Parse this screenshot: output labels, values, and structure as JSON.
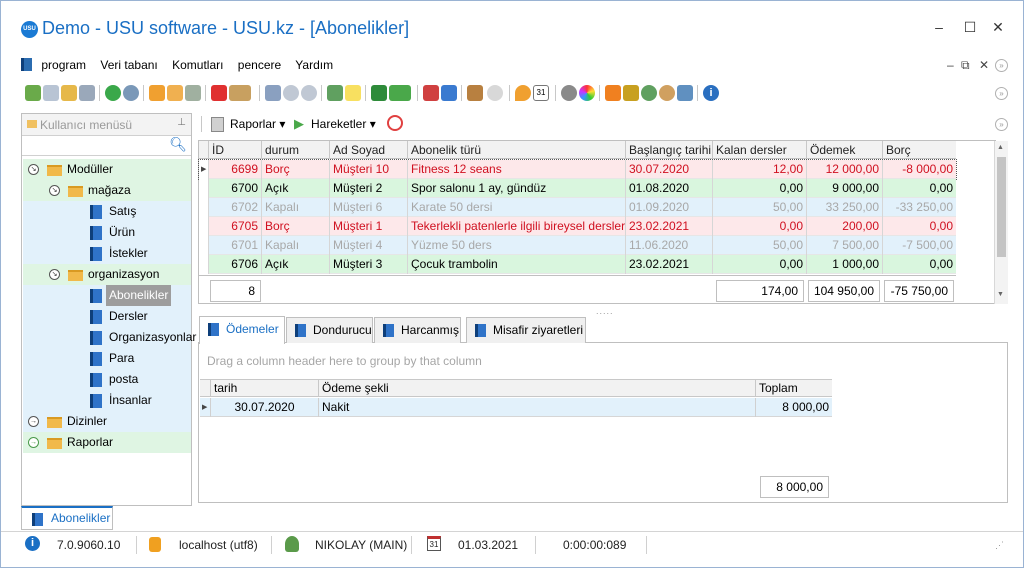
{
  "window": {
    "title": "Demo - USU software - USU.kz - [Abonelikler]",
    "app_icon_text": "USU",
    "controls": [
      "–",
      "☐",
      "✕"
    ]
  },
  "menu": {
    "items": [
      "program",
      "Veri tabanı",
      "Komutları",
      "pencere",
      "Yardım"
    ],
    "mdi_controls": [
      "–",
      "⧉",
      "✕"
    ]
  },
  "sidebar": {
    "title": "Kullanıcı menüsü",
    "items": [
      {
        "label": "Modüller",
        "kind": "root"
      },
      {
        "label": "mağaza",
        "kind": "folder"
      },
      {
        "label": "Satış",
        "kind": "leaf"
      },
      {
        "label": "Ürün",
        "kind": "leaf"
      },
      {
        "label": "İstekler",
        "kind": "leaf"
      },
      {
        "label": "organizasyon",
        "kind": "folder"
      },
      {
        "label": "Abonelikler",
        "kind": "leaf-selected"
      },
      {
        "label": "Dersler",
        "kind": "leaf"
      },
      {
        "label": "Organizasyonlar",
        "kind": "leaf"
      },
      {
        "label": "Para",
        "kind": "leaf"
      },
      {
        "label": "posta",
        "kind": "leaf"
      },
      {
        "label": "İnsanlar",
        "kind": "leaf"
      },
      {
        "label": "Dizinler",
        "kind": "root"
      },
      {
        "label": "Raporlar",
        "kind": "root"
      }
    ]
  },
  "actions": {
    "reports": "Raporlar",
    "actions": "Hareketler"
  },
  "grid": {
    "columns": [
      "İD",
      "durum",
      "Ad Soyad",
      "Abonelik türü",
      "Başlangıç tarihi",
      "Kalan dersler",
      "Ödemek",
      "Borç"
    ],
    "rows": [
      {
        "id": "6699",
        "durum": "Borç",
        "ad": "Müşteri 10",
        "tur": "Fitness 12 seans",
        "tarih": "30.07.2020",
        "kalan": "12,00",
        "odemek": "12 000,00",
        "borc": "-8 000,00",
        "style": "red"
      },
      {
        "id": "6700",
        "durum": "Açık",
        "ad": "Müşteri 2",
        "tur": "Spor salonu 1 ay, gündüz",
        "tarih": "01.08.2020",
        "kalan": "0,00",
        "odemek": "9 000,00",
        "borc": "0,00",
        "style": "green"
      },
      {
        "id": "6702",
        "durum": "Kapalı",
        "ad": "Müşteri 6",
        "tur": "Karate 50 dersi",
        "tarih": "01.09.2020",
        "kalan": "50,00",
        "odemek": "33 250,00",
        "borc": "-33 250,00",
        "style": "gray"
      },
      {
        "id": "6705",
        "durum": "Borç",
        "ad": "Müşteri 1",
        "tur": "Tekerlekli patenlerle ilgili bireysel dersler",
        "tarih": "23.02.2021",
        "kalan": "0,00",
        "odemek": "200,00",
        "borc": "0,00",
        "style": "red"
      },
      {
        "id": "6701",
        "durum": "Kapalı",
        "ad": "Müşteri 4",
        "tur": "Yüzme 50 ders",
        "tarih": "11.06.2020",
        "kalan": "50,00",
        "odemek": "7 500,00",
        "borc": "-7 500,00",
        "style": "gray"
      },
      {
        "id": "6706",
        "durum": "Açık",
        "ad": "Müşteri 3",
        "tur": "Çocuk trambolin",
        "tarih": "23.02.2021",
        "kalan": "0,00",
        "odemek": "1 000,00",
        "borc": "0,00",
        "style": "green"
      }
    ],
    "footer": {
      "count": "8",
      "kalan": "174,00",
      "odemek": "104 950,00",
      "borc": "-75 750,00"
    }
  },
  "tabs": [
    "Ödemeler",
    "Dondurucu",
    "Harcanmış",
    "Misafir ziyaretleri"
  ],
  "subgrid": {
    "group_hint": "Drag a column header here to group by that column",
    "columns": [
      "tarih",
      "Ödeme şekli",
      "Toplam"
    ],
    "rows": [
      {
        "tarih": "30.07.2020",
        "sekil": "Nakit",
        "toplam": "8 000,00"
      }
    ],
    "footer_total": "8 000,00"
  },
  "bottom_tab": "Abonelikler",
  "status": {
    "version": "7.0.9060.10",
    "server": "localhost (utf8)",
    "user": "NIKOLAY (MAIN)",
    "date": "01.03.2021",
    "timer": "0:00:00:089",
    "calendar_day": "31"
  }
}
